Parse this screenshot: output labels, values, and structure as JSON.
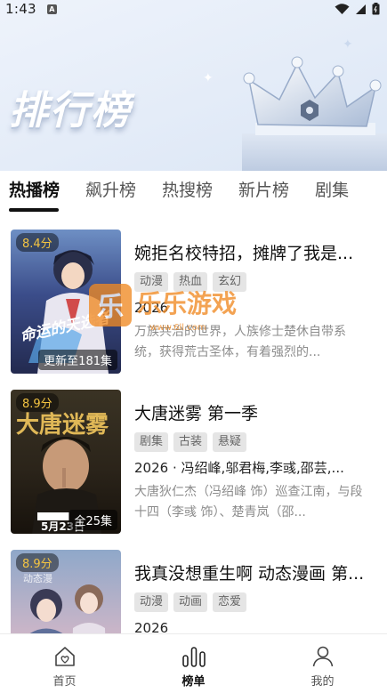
{
  "status_bar": {
    "time": "1:43"
  },
  "banner": {
    "title": "排行榜"
  },
  "tabs": [
    {
      "label": "热播榜",
      "active": true
    },
    {
      "label": "飙升榜",
      "active": false
    },
    {
      "label": "热搜榜",
      "active": false
    },
    {
      "label": "新片榜",
      "active": false
    },
    {
      "label": "剧集",
      "active": false
    }
  ],
  "items": [
    {
      "score": "8.4分",
      "episodes": "更新至181集",
      "title": "婉拒名校特招，摊牌了我是...",
      "tags": [
        "动漫",
        "热血",
        "玄幻"
      ],
      "meta": "2026",
      "desc": "万族共治的世界，人族修士楚休自带系统，获得荒古圣体，有着强烈的..."
    },
    {
      "score": "8.9分",
      "episodes": "全25集",
      "title": "大唐迷雾 第一季",
      "tags": [
        "剧集",
        "古装",
        "悬疑"
      ],
      "meta": "2026 · 冯绍峰,邬君梅,李彧,邵芸,...",
      "desc": "大唐狄仁杰（冯绍峰 饰）巡查江南，与段十四（李彧 饰）、楚青岚（邵..."
    },
    {
      "score": "8.9分",
      "episodes": "",
      "title": "我真没想重生啊 动态漫画 第...",
      "tags": [
        "动漫",
        "动画",
        "恋爱"
      ],
      "meta": "2026",
      "desc": ""
    }
  ],
  "poster_text": {
    "item1": "命运的天选者",
    "item2_title": "大唐迷雾",
    "item2_date": "5月23日",
    "item3": "动态漫"
  },
  "watermark": {
    "text": "乐乐游戏",
    "url": "www.6ll.com"
  },
  "bottom_nav": [
    {
      "label": "首页",
      "icon": "home-icon",
      "active": false
    },
    {
      "label": "榜单",
      "icon": "chart-bars-icon",
      "active": true
    },
    {
      "label": "我的",
      "icon": "person-icon",
      "active": false
    }
  ],
  "colors": {
    "score": "#f5c542",
    "tag_bg": "#e5e5e5",
    "accent": "#111111"
  }
}
